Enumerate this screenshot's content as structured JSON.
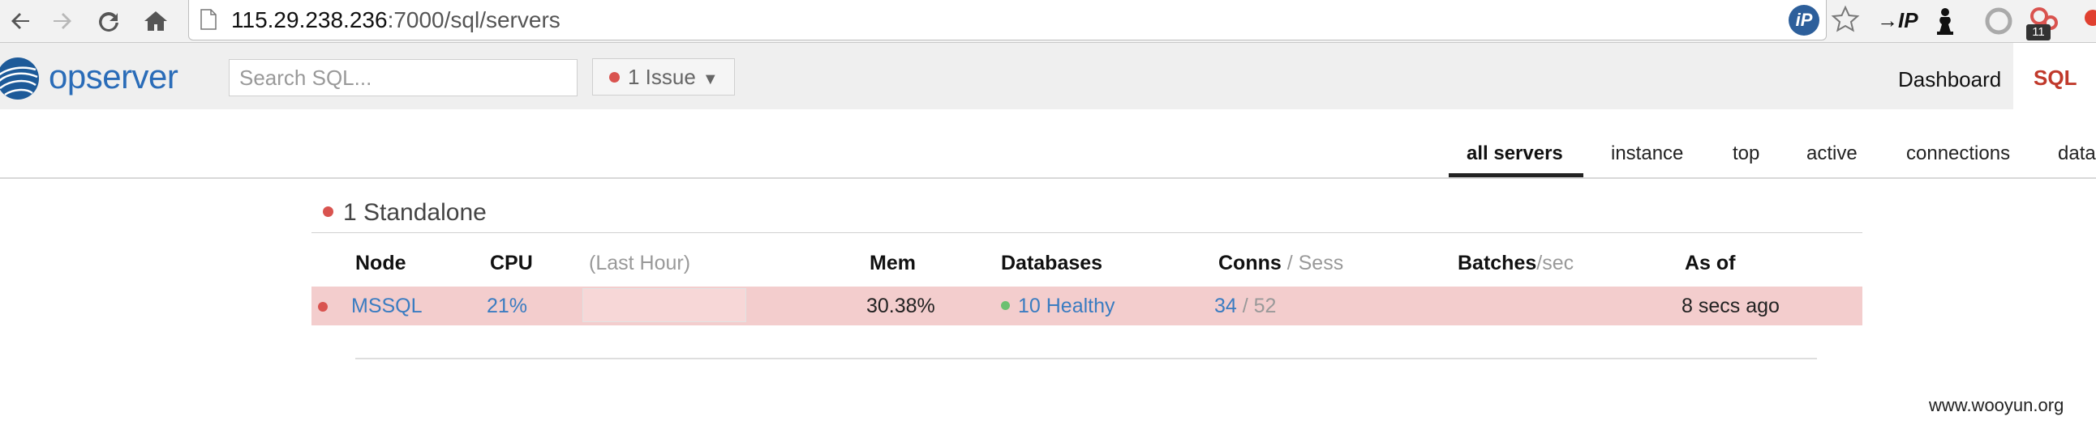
{
  "browser": {
    "url_host": "115.29.238.236",
    "url_rest": ":7000/sql/servers",
    "extension_ip_label": "iP",
    "extension_ip2_label": "→IP",
    "extension_badge": "11"
  },
  "header": {
    "brand": "opserver",
    "search_placeholder": "Search SQL...",
    "issue_label": "1 Issue",
    "nav": {
      "dashboard": "Dashboard",
      "sql": "SQL"
    }
  },
  "subtabs": [
    "all servers",
    "instance",
    "top",
    "active",
    "connections",
    "data"
  ],
  "section": {
    "title": "1 Standalone",
    "columns": {
      "node": "Node",
      "cpu": "CPU",
      "last_hour": "(Last Hour)",
      "mem": "Mem",
      "databases": "Databases",
      "conns": "Conns",
      "sess": " / Sess",
      "batches": "Batches",
      "per_sec": "/sec",
      "as_of": "As of"
    },
    "rows": [
      {
        "node": "MSSQL",
        "cpu": "21%",
        "mem": "30.38%",
        "databases": "10 Healthy",
        "conns": "34",
        "sess": " / 52",
        "as_of": "8 secs ago"
      }
    ]
  },
  "colors": {
    "brand_blue": "#2a6cb8",
    "issue_red": "#d9534f",
    "healthy_green": "#6cc070",
    "row_highlight": "#f3cdcd",
    "link_blue": "#3a7cc1"
  },
  "watermark": "www.wooyun.org"
}
